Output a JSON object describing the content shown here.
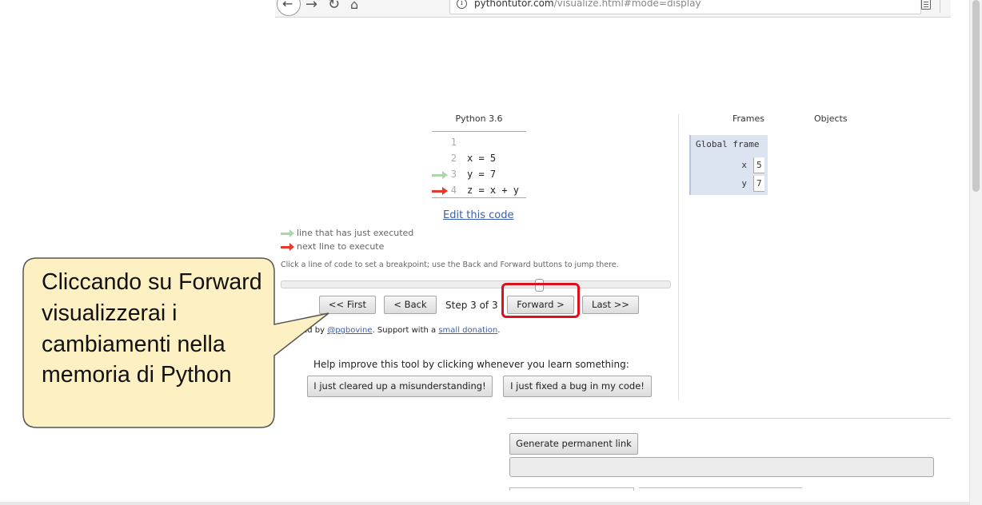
{
  "browser": {
    "url_host": "pythontutor.com",
    "url_path": "/visualize.html#mode=display"
  },
  "code_panel": {
    "language": "Python 3.6",
    "lines": [
      {
        "number": "1",
        "code": ""
      },
      {
        "number": "2",
        "code": "x = 5"
      },
      {
        "number": "3",
        "code": "y = 7"
      },
      {
        "number": "4",
        "code": "z = x + y"
      }
    ],
    "edit_link": "Edit this code",
    "legend_executed": "line that has just executed",
    "legend_next": "next line to execute",
    "hint": "Click a line of code to set a breakpoint; use the Back and Forward buttons to jump there.",
    "progress": {
      "current_step": 3,
      "total_steps": 3
    }
  },
  "controls": {
    "first": "<< First",
    "back": "< Back",
    "step_text": "Step 3 of 3",
    "forward": "Forward >",
    "last": "Last >>"
  },
  "credits": {
    "prefix": "Created by ",
    "author": "@pgbovine",
    "middle": ". Support with a ",
    "donation": "small donation",
    "suffix": "."
  },
  "feedback": {
    "prompt": "Help improve this tool by clicking whenever you learn something:",
    "btn_misunderstanding": "I just cleared up a misunderstanding!",
    "btn_bug": "I just fixed a bug in my code!"
  },
  "frames_panel": {
    "frames_heading": "Frames",
    "objects_heading": "Objects",
    "frame_title": "Global frame",
    "variables": [
      {
        "name": "x",
        "value": "5"
      },
      {
        "name": "y",
        "value": "7"
      }
    ]
  },
  "permalink": {
    "button": "Generate permanent link"
  },
  "callout": {
    "text": "Cliccando su Forward visualizzerai i cambiamenti nella memoria di Python",
    "fill_color": "#fdf0c2",
    "border_color": "#555555"
  },
  "colors": {
    "executed_arrow": "#a9d9a9",
    "next_arrow": "#e8392c",
    "highlight_border": "#e0101c",
    "frame_bg": "#dde4f1",
    "link": "#3a5ea8"
  }
}
